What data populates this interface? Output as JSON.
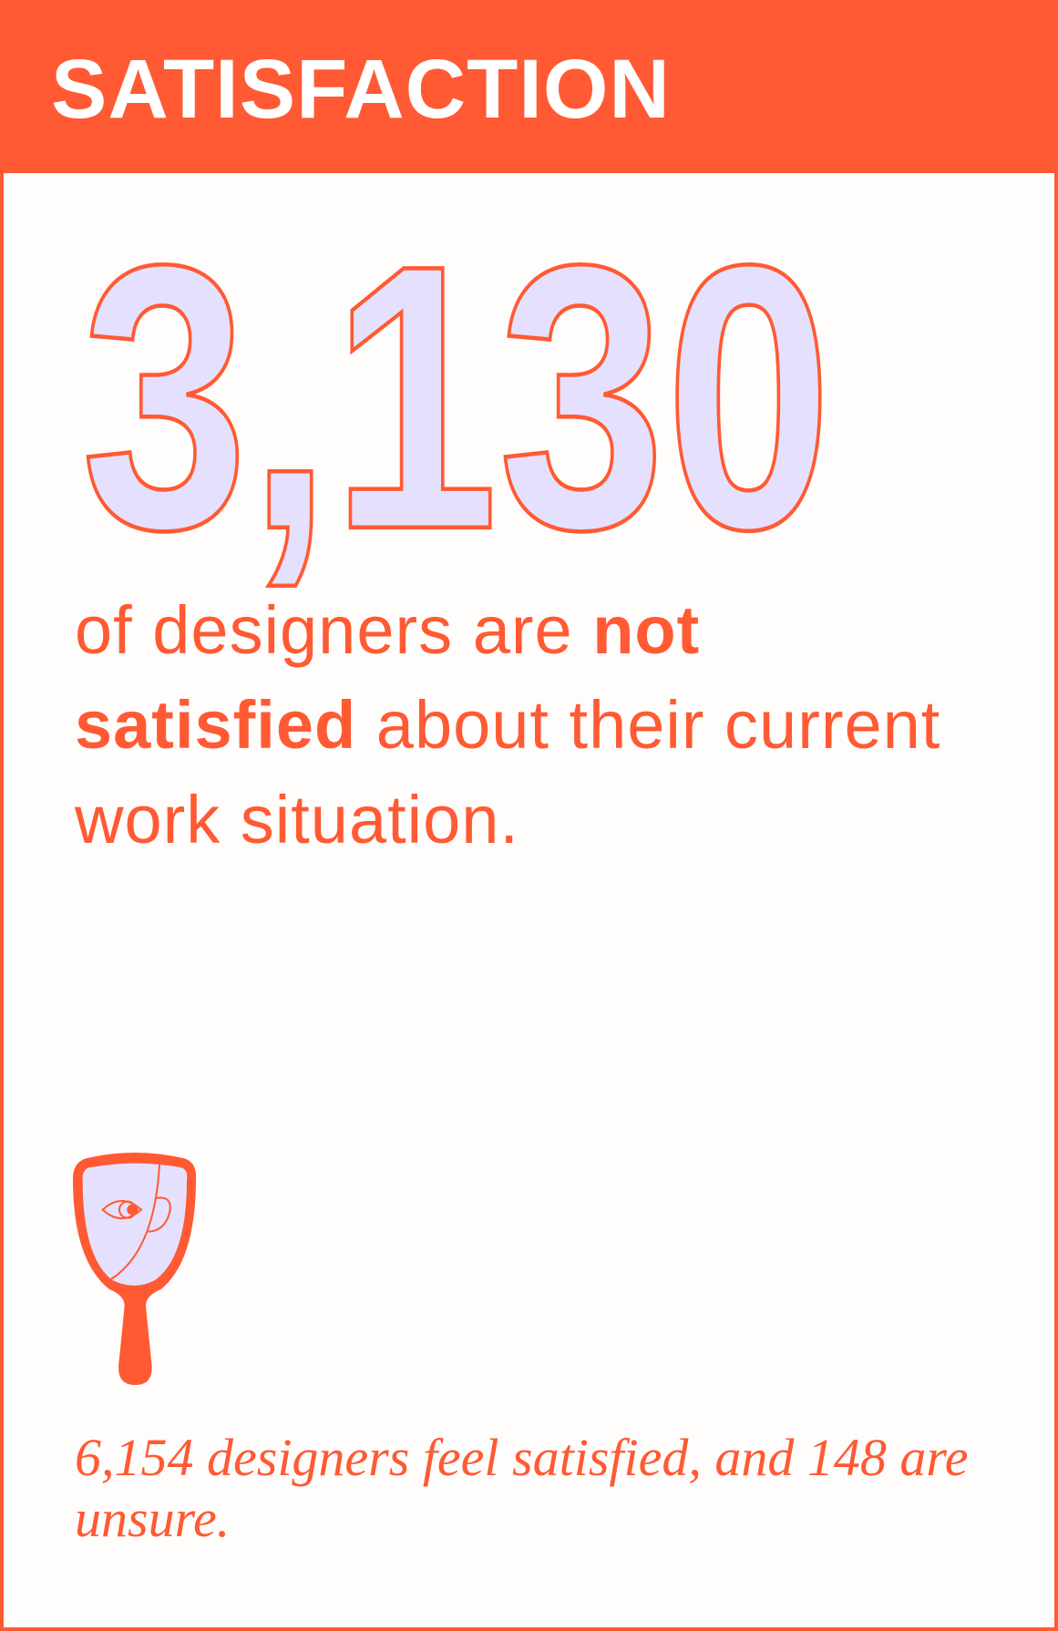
{
  "header": {
    "title": "SATISFACTION"
  },
  "stat": {
    "number": "3,130",
    "text_before": "of designers are ",
    "text_bold": "not satisfied",
    "text_after": " about their current work situation."
  },
  "footnote": "6,154 designers feel satisfied, and 148 are unsure.",
  "icons": {
    "illustration": "hand-mirror-icon"
  },
  "colors": {
    "accent": "#ff5a33",
    "fill": "#e6e0ff",
    "background": "#fffdfb"
  }
}
